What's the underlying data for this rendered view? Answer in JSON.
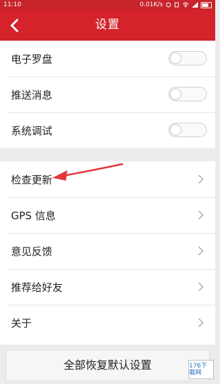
{
  "status_bar": {
    "time": "11:10",
    "speed": "0.01K/s"
  },
  "header": {
    "title": "设置"
  },
  "toggle_group": [
    {
      "label": "电子罗盘",
      "enabled": false
    },
    {
      "label": "推送消息",
      "enabled": false
    },
    {
      "label": "系统调试",
      "enabled": false
    }
  ],
  "nav_group": [
    {
      "label": "检查更新"
    },
    {
      "label": "GPS 信息"
    },
    {
      "label": "意见反馈"
    },
    {
      "label": "推荐给好友"
    },
    {
      "label": "关于"
    }
  ],
  "reset_button": {
    "label": "全部恢复默认设置"
  },
  "watermark": {
    "line1": "176下载网"
  },
  "colors": {
    "accent": "#d4232b",
    "annotation_arrow": "#e2363c"
  }
}
